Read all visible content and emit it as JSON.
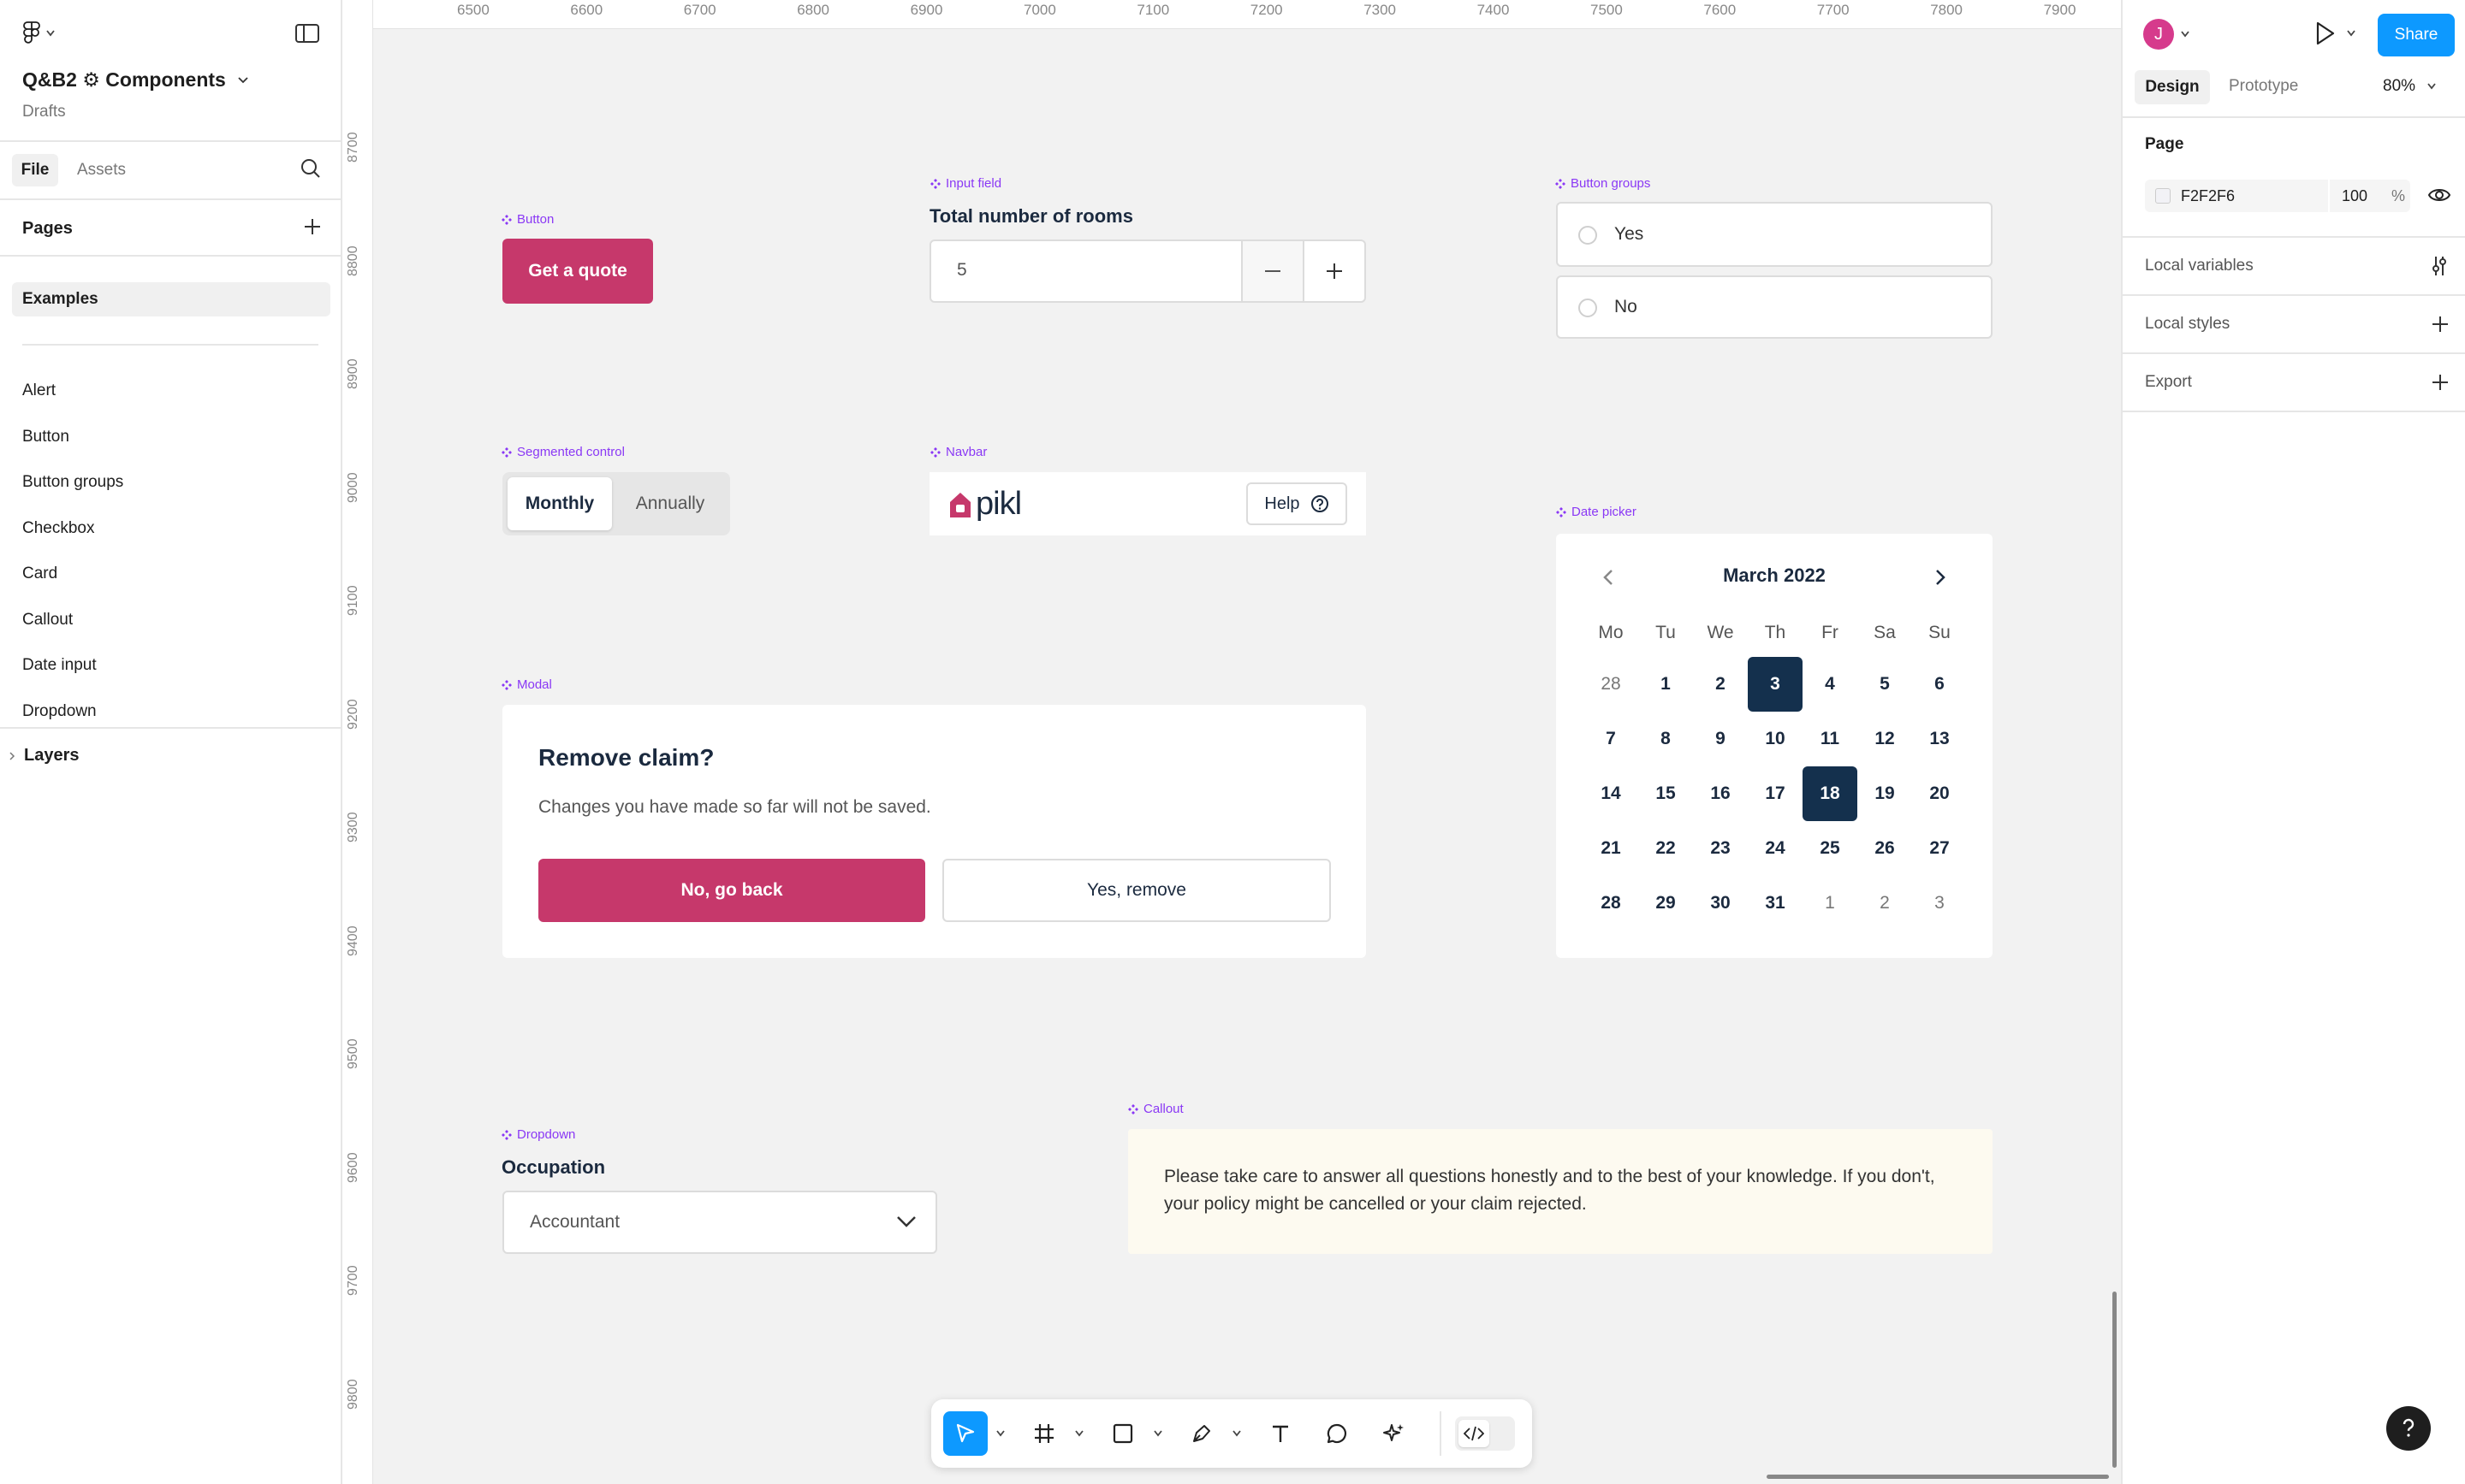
{
  "file": {
    "name": "Q&B2 ⚙ Components",
    "location": "Drafts"
  },
  "left_tabs": {
    "file": "File",
    "assets": "Assets"
  },
  "pages_label": "Pages",
  "current_page": "Examples",
  "pages": [
    "Alert",
    "Button",
    "Button groups",
    "Checkbox",
    "Card",
    "Callout",
    "Date input",
    "Dropdown"
  ],
  "layers_label": "Layers",
  "ruler_x": [
    "6500",
    "6600",
    "6700",
    "6800",
    "6900",
    "7000",
    "7100",
    "7200",
    "7300",
    "7400",
    "7500",
    "7600",
    "7700",
    "7800",
    "7900"
  ],
  "ruler_y": [
    "8700",
    "8800",
    "8900",
    "9000",
    "9100",
    "9200",
    "9300",
    "9400",
    "9500",
    "9600",
    "9700",
    "9800"
  ],
  "components": {
    "button": {
      "label": "Button",
      "text": "Get a quote"
    },
    "input": {
      "label": "Input field",
      "title": "Total number of rooms",
      "value": "5"
    },
    "button_groups": {
      "label": "Button groups",
      "options": [
        "Yes",
        "No"
      ]
    },
    "segmented": {
      "label": "Segmented control",
      "options": [
        "Monthly",
        "Annually"
      ]
    },
    "navbar": {
      "label": "Navbar",
      "logo": "pikl",
      "help": "Help"
    },
    "modal": {
      "label": "Modal",
      "title": "Remove claim?",
      "body": "Changes you have made so far will not be saved.",
      "primary": "No, go back",
      "secondary": "Yes, remove"
    },
    "datepicker": {
      "label": "Date picker",
      "month": "March 2022",
      "weekdays": [
        "Mo",
        "Tu",
        "We",
        "Th",
        "Fr",
        "Sa",
        "Su"
      ],
      "weeks": [
        [
          "28",
          "1",
          "2",
          "3",
          "4",
          "5",
          "6"
        ],
        [
          "7",
          "8",
          "9",
          "10",
          "11",
          "12",
          "13"
        ],
        [
          "14",
          "15",
          "16",
          "17",
          "18",
          "19",
          "20"
        ],
        [
          "21",
          "22",
          "23",
          "24",
          "25",
          "26",
          "27"
        ],
        [
          "28",
          "29",
          "30",
          "31",
          "1",
          "2",
          "3"
        ]
      ],
      "selected": [
        "3",
        "18"
      ]
    },
    "dropdown": {
      "label": "Dropdown",
      "title": "Occupation",
      "value": "Accountant"
    },
    "callout": {
      "label": "Callout",
      "text": "Please take care to answer all questions honestly and to the best of your knowledge. If you don't, your policy might be cancelled or your claim rejected."
    }
  },
  "right": {
    "avatar": "J",
    "share": "Share",
    "tabs": [
      "Design",
      "Prototype"
    ],
    "zoom": "80%",
    "page_section": "Page",
    "bg_hex": "F2F2F6",
    "opacity": "100",
    "pct": "%",
    "sections": [
      "Local variables",
      "Local styles",
      "Export"
    ]
  },
  "colors": {
    "brand": "#C6386B",
    "accent": "#0d99ff",
    "navy": "#14304d",
    "callout_bg": "#FDFAF0",
    "component_label": "#8A38F5"
  }
}
